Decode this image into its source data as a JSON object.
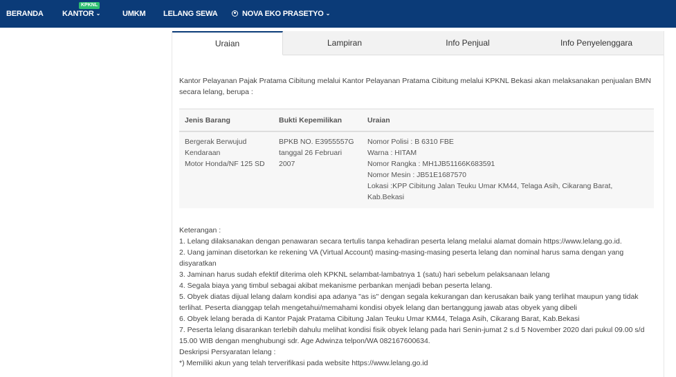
{
  "navbar": {
    "beranda": "BERANDA",
    "kantor": "KANTOR",
    "kpknl_badge": "KPKNL",
    "umkm": "UMKM",
    "lelang_sewa": "LELANG SEWA",
    "user_name": "NOVA EKO PRASETYO",
    "bg_color": "#0b3b78"
  },
  "tabs": [
    {
      "label": "Uraian",
      "active": true
    },
    {
      "label": "Lampiran",
      "active": false
    },
    {
      "label": "Info Penjual",
      "active": false
    },
    {
      "label": "Info Penyelenggara",
      "active": false
    }
  ],
  "content": {
    "intro": "Kantor Pelayanan Pajak Pratama Cibitung melalui Kantor Pelayanan Pratama Cibitung melalui KPKNL Bekasi akan melaksanakan penjualan BMN secara lelang, berupa :",
    "table": {
      "headers": [
        "Jenis Barang",
        "Bukti Kepemilikan",
        "Uraian"
      ],
      "row": {
        "jenis": [
          "Bergerak Berwujud",
          "Kendaraan",
          "Motor Honda/NF 125 SD"
        ],
        "bukti": [
          "BPKB NO. E3955557G",
          "tanggal 26 Februari 2007"
        ],
        "uraian": [
          "Nomor Polisi : B 6310 FBE",
          "Warna : HITAM",
          "Nomor Rangka : MH1JB51166K683591",
          "Nomor Mesin : JB51E1687570",
          "Lokasi :KPP Cibitung Jalan Teuku Umar KM44, Telaga Asih, Cikarang Barat, Kab.Bekasi"
        ]
      }
    },
    "keterangan_title": "Keterangan :",
    "keterangan": [
      "1. Lelang dilaksanakan dengan penawaran secara tertulis tanpa kehadiran peserta lelang melalui alamat domain https://www.lelang.go.id.",
      "2. Uang jaminan disetorkan ke rekening VA (Virtual Account) masing-masing-masing peserta lelang dan nominal harus sama dengan yang disyaratkan",
      "3. Jaminan harus sudah efektif diterima oleh KPKNL selambat-lambatnya 1 (satu) hari sebelum pelaksanaan lelang",
      "4. Segala biaya yang timbul sebagai akibat mekanisme perbankan menjadi beban peserta lelang.",
      "5. Obyek diatas dijual lelang dalam kondisi apa adanya \"as is\" dengan segala kekurangan dan kerusakan baik yang terlihat maupun yang tidak terlihat. Peserta dianggap telah mengetahui/memahami kondisi obyek lelang dan bertanggung jawab atas obyek yang dibeli",
      "6. Obyek lelang berada di Kantor Pajak Pratama Cibitung Jalan Teuku Umar KM44, Telaga Asih, Cikarang Barat, Kab.Bekasi",
      "7. Peserta lelang disarankan terlebih dahulu melihat kondisi fisik obyek lelang pada hari Senin-jumat 2 s.d 5 November 2020 dari pukul 09.00 s/d 15.00 WIB dengan menghubungi sdr. Age Adwinza telpon/WA 082167600634.",
      "Deskripsi Persyaratan lelang :",
      "*) Memiliki akun yang telah terverifikasi pada website https://www.lelang.go.id"
    ]
  }
}
